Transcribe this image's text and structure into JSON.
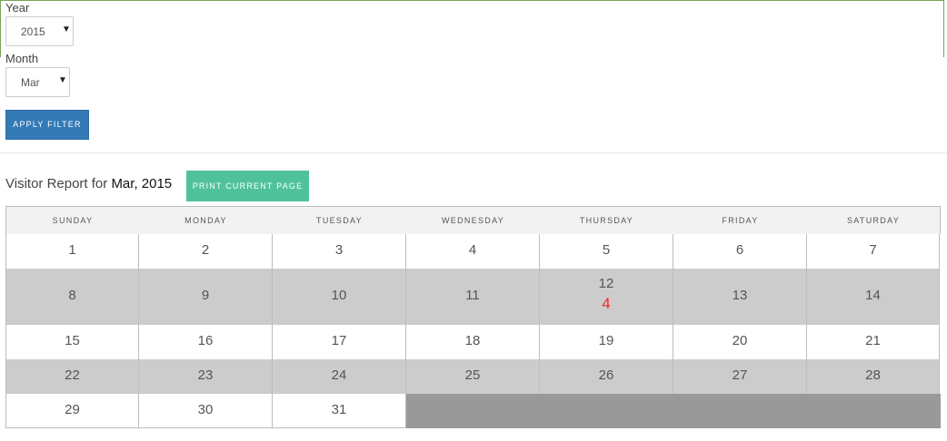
{
  "filters": {
    "year_label": "Year",
    "year_value": "2015",
    "month_label": "Month",
    "month_value": "Mar",
    "apply_label": "APPLY FILTER"
  },
  "report": {
    "title_prefix": "Visitor Report for",
    "title_period": "Mar, 2015",
    "print_label": "PRINT CURRENT PAGE"
  },
  "calendar": {
    "weekdays": [
      "SUNDAY",
      "MONDAY",
      "TUESDAY",
      "WEDNESDAY",
      "THURSDAY",
      "FRIDAY",
      "SATURDAY"
    ],
    "weeks": [
      [
        "1",
        "2",
        "3",
        "4",
        "5",
        "6",
        "7"
      ],
      [
        "8",
        "9",
        "10",
        "11",
        "12",
        "13",
        "14"
      ],
      [
        "15",
        "16",
        "17",
        "18",
        "19",
        "20",
        "21"
      ],
      [
        "22",
        "23",
        "24",
        "25",
        "26",
        "27",
        "28"
      ],
      [
        "29",
        "30",
        "31",
        "",
        "",
        "",
        ""
      ]
    ],
    "visitor_counts": [
      [
        "",
        "",
        "",
        "",
        "",
        "",
        ""
      ],
      [
        "",
        "",
        "",
        "",
        "4",
        "",
        ""
      ],
      [
        "",
        "",
        "",
        "",
        "",
        "",
        ""
      ],
      [
        "",
        "",
        "",
        "",
        "",
        "",
        ""
      ],
      [
        "",
        "",
        "",
        "",
        "",
        "",
        ""
      ]
    ]
  },
  "colors": {
    "row_light": "#ffffff",
    "row_shaded": "#cccccc",
    "empty_fill": "#999999",
    "count_color": "#ff2222",
    "apply_button": "#337ab7",
    "print_button": "#4fc29c"
  }
}
